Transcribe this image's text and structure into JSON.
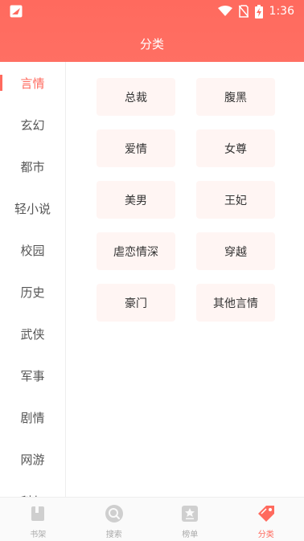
{
  "status_bar": {
    "time": "1:36"
  },
  "header": {
    "title": "分类"
  },
  "sidebar": {
    "items": [
      {
        "label": "言情",
        "active": true
      },
      {
        "label": "玄幻"
      },
      {
        "label": "都市"
      },
      {
        "label": "轻小说"
      },
      {
        "label": "校园"
      },
      {
        "label": "历史"
      },
      {
        "label": "武侠"
      },
      {
        "label": "军事"
      },
      {
        "label": "剧情"
      },
      {
        "label": "网游"
      },
      {
        "label": "科幻"
      }
    ]
  },
  "categories": [
    "总裁",
    "腹黑",
    "爱情",
    "女尊",
    "美男",
    "王妃",
    "虐恋情深",
    "穿越",
    "豪门",
    "其他言情"
  ],
  "tabbar": {
    "tabs": [
      {
        "label": "书架",
        "icon": "bookshelf-icon"
      },
      {
        "label": "搜索",
        "icon": "search-icon"
      },
      {
        "label": "榜单",
        "icon": "ranking-icon"
      },
      {
        "label": "分类",
        "icon": "category-tag-icon",
        "active": true
      }
    ]
  },
  "colors": {
    "accent": "#ff6a5e",
    "chip_bg": "#fff5f3",
    "inactive": "#aaaaaa"
  }
}
